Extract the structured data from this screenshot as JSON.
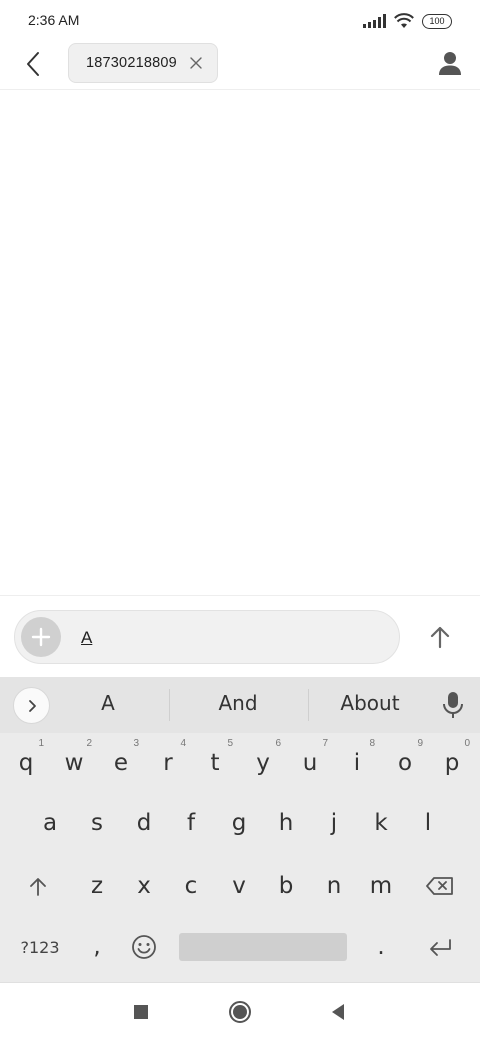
{
  "status": {
    "time": "2:36 AM",
    "battery": "100"
  },
  "header": {
    "recipient": "18730218809"
  },
  "compose": {
    "text": "A"
  },
  "keyboard": {
    "suggestions": [
      "A",
      "And",
      "About"
    ],
    "row1": [
      "q",
      "w",
      "e",
      "r",
      "t",
      "y",
      "u",
      "i",
      "o",
      "p"
    ],
    "row1_hints": [
      "1",
      "2",
      "3",
      "4",
      "5",
      "6",
      "7",
      "8",
      "9",
      "0"
    ],
    "row2": [
      "a",
      "s",
      "d",
      "f",
      "g",
      "h",
      "j",
      "k",
      "l"
    ],
    "row3": [
      "z",
      "x",
      "c",
      "v",
      "b",
      "n",
      "m"
    ],
    "symbols_label": "?123",
    "comma": ",",
    "period": "."
  },
  "icons": {
    "back": "arrow-left-icon",
    "chip_close": "close-icon",
    "contact": "person-icon",
    "attach": "plus-icon",
    "send": "arrow-up-icon",
    "suggest_toggle": "chevron-right-icon",
    "mic": "microphone-icon",
    "shift": "shift-arrow-icon",
    "backspace": "backspace-icon",
    "emoji": "emoji-icon",
    "enter": "enter-icon",
    "nav_recents": "square-icon",
    "nav_home": "circle-icon",
    "nav_back": "triangle-back-icon"
  },
  "colors": {
    "keyboard_bg": "#ebebeb",
    "suggest_bg": "#e4e4e4",
    "input_bg": "#f1f1f1",
    "attach_bg": "#d0d0d0"
  }
}
